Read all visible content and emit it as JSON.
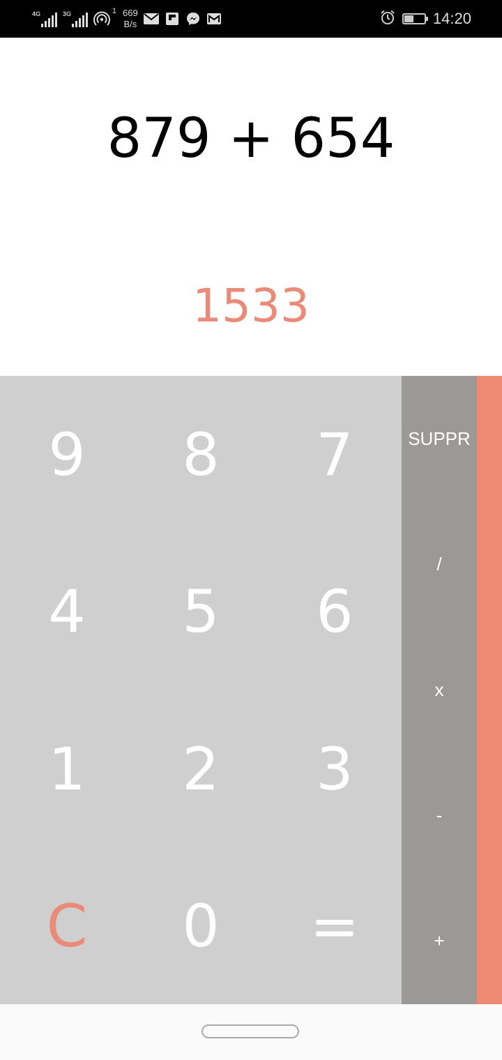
{
  "status_bar": {
    "signal1_type": "4G",
    "signal2_type": "3G",
    "hotspot_count": "1",
    "speed_value": "669",
    "speed_unit": "B/s",
    "notifications": [
      "mail-icon",
      "flipboard-icon",
      "messenger-icon",
      "gmail-icon"
    ],
    "battery_level_percent": 45,
    "time": "14:20"
  },
  "display": {
    "expression": "879 + 654",
    "result": "1533"
  },
  "keypad": {
    "keys": [
      "9",
      "8",
      "7",
      "4",
      "5",
      "6",
      "1",
      "2",
      "3",
      "C",
      "0",
      "="
    ]
  },
  "operators": {
    "delete_label": "SUPPR",
    "divide_label": "/",
    "multiply_label": "x",
    "subtract_label": "-",
    "add_label": "+"
  },
  "colors": {
    "accent": "#EA8A78",
    "keypad_bg": "#CFCFCF",
    "operators_bg": "#9A9997",
    "drawer_bg": "#EE8A74",
    "key_text": "#FFFFFF"
  }
}
